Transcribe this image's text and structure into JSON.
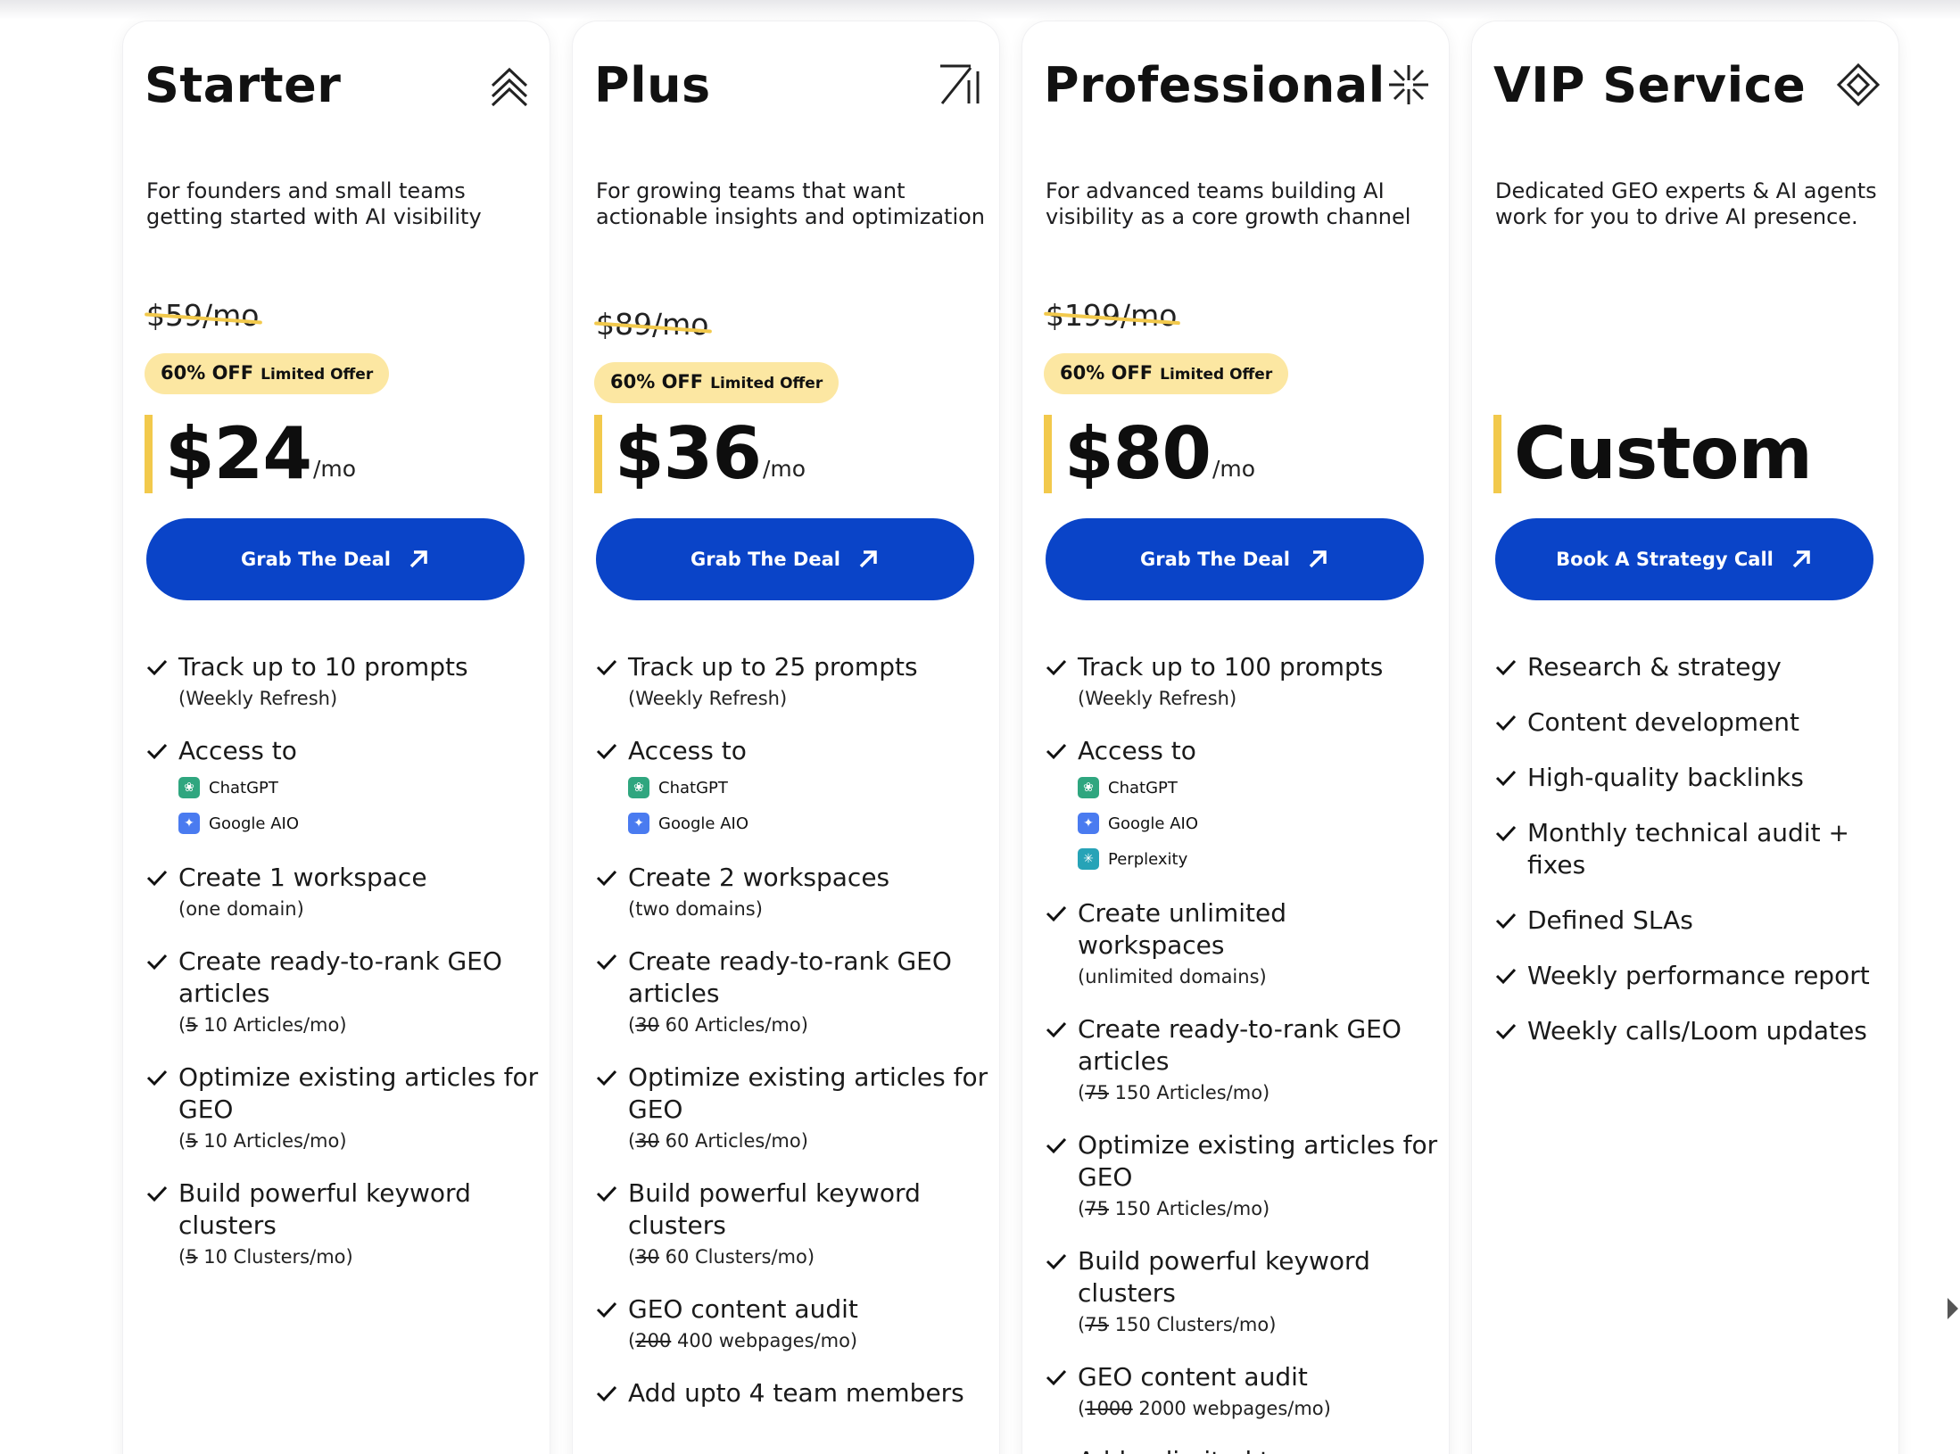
{
  "plans": [
    {
      "name": "Starter",
      "icon": "double-chevron-up-icon",
      "description": "For founders and small teams getting started with AI visibility",
      "old_price": "$59/mo",
      "discount": "60% OFF",
      "discount_note": "Limited Offer",
      "price": "$24",
      "per": "/mo",
      "cta": "Grab The Deal",
      "features": [
        {
          "title": "Track up to 10 prompts",
          "sub": "(Weekly Refresh)"
        },
        {
          "title": "Access to",
          "models": [
            "ChatGPT",
            "Google AIO"
          ]
        },
        {
          "title": "Create 1 workspace",
          "sub": "(one domain)"
        },
        {
          "title": "Create ready-to-rank GEO articles",
          "sub_open": "(",
          "sub_old": "5",
          "sub_new": " 10 Articles/mo)"
        },
        {
          "title": "Optimize existing articles for GEO",
          "sub_open": "(",
          "sub_old": "5",
          "sub_new": " 10 Articles/mo)"
        },
        {
          "title": "Build powerful keyword clusters",
          "sub_open": "(",
          "sub_old": "5",
          "sub_new": " 10 Clusters/mo)"
        }
      ]
    },
    {
      "name": "Plus",
      "icon": "arrow-up-right-bars-icon",
      "description": "For growing teams that want actionable insights and optimization",
      "old_price": "$89/mo",
      "discount": "60% OFF",
      "discount_note": "Limited Offer",
      "price": "$36",
      "per": "/mo",
      "cta": "Grab The Deal",
      "features": [
        {
          "title": "Track up to 25 prompts",
          "sub": "(Weekly Refresh)"
        },
        {
          "title": "Access to",
          "models": [
            "ChatGPT",
            "Google AIO"
          ]
        },
        {
          "title": "Create 2 workspaces",
          "sub": "(two domains)"
        },
        {
          "title": "Create ready-to-rank GEO articles",
          "sub_open": "(",
          "sub_old": "30",
          "sub_new": " 60 Articles/mo)"
        },
        {
          "title": "Optimize existing articles for GEO",
          "sub_open": "(",
          "sub_old": "30",
          "sub_new": " 60 Articles/mo)"
        },
        {
          "title": "Build powerful keyword clusters",
          "sub_open": "(",
          "sub_old": "30",
          "sub_new": " 60 Clusters/mo)"
        },
        {
          "title": "GEO content audit",
          "sub_open": "(",
          "sub_old": "200",
          "sub_new": " 400 webpages/mo)"
        },
        {
          "title": "Add upto 4 team members"
        }
      ]
    },
    {
      "name": "Professional",
      "icon": "sparkle-burst-icon",
      "description": "For advanced teams building AI visibility as a core growth channel",
      "old_price": "$199/mo",
      "discount": "60% OFF",
      "discount_note": "Limited Offer",
      "price": "$80",
      "per": "/mo",
      "cta": "Grab The Deal",
      "features": [
        {
          "title": "Track up to 100 prompts",
          "sub": "(Weekly Refresh)"
        },
        {
          "title": "Access to",
          "models": [
            "ChatGPT",
            "Google AIO",
            "Perplexity"
          ]
        },
        {
          "title": "Create unlimited workspaces",
          "sub": "(unlimited domains)"
        },
        {
          "title": "Create ready-to-rank GEO articles",
          "sub_open": "(",
          "sub_old": "75",
          "sub_new": " 150 Articles/mo)"
        },
        {
          "title": "Optimize existing articles for GEO",
          "sub_open": "(",
          "sub_old": "75",
          "sub_new": " 150 Articles/mo)"
        },
        {
          "title": "Build powerful keyword clusters",
          "sub_open": "(",
          "sub_old": "75",
          "sub_new": " 150 Clusters/mo)"
        },
        {
          "title": "GEO content audit",
          "sub_open": "(",
          "sub_old": "1000",
          "sub_new": " 2000 webpages/mo)"
        },
        {
          "title": "Add unlimited team"
        }
      ]
    },
    {
      "name": "VIP Service",
      "icon": "diamond-icon",
      "description": "Dedicated GEO experts & AI agents work for you to drive AI presence.",
      "price": "Custom",
      "cta": "Book A Strategy Call",
      "features": [
        {
          "title": "Research & strategy"
        },
        {
          "title": "Content development"
        },
        {
          "title": "High-quality backlinks"
        },
        {
          "title": "Monthly technical audit + fixes"
        },
        {
          "title": "Defined SLAs"
        },
        {
          "title": "Weekly performance report"
        },
        {
          "title": "Weekly calls/Loom updates"
        }
      ]
    }
  ],
  "colors": {
    "cta_blue": "#0a44c8",
    "badge_yellow": "#fce7a2",
    "accent_yellow": "#f2c94c"
  }
}
